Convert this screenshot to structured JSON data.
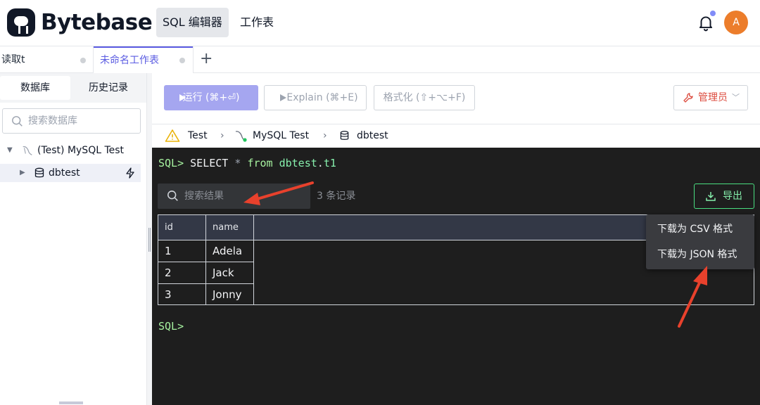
{
  "app": {
    "brand": "Bytebase",
    "accent": "#5b5ce2"
  },
  "header": {
    "nav": [
      {
        "label": "SQL 编辑器",
        "active": true
      },
      {
        "label": "工作表",
        "active": false
      }
    ],
    "avatar_initial": "A"
  },
  "tabs": [
    {
      "label": "读取t",
      "active": false
    },
    {
      "label": "未命名工作表",
      "active": true
    }
  ],
  "sidebar": {
    "tabs": [
      {
        "label": "数据库",
        "active": true
      },
      {
        "label": "历史记录",
        "active": false
      }
    ],
    "search_placeholder": "搜索数据库",
    "tree": [
      {
        "label": "(Test) MySQL Test",
        "expanded": true
      },
      {
        "label": "dbtest",
        "selected": true
      }
    ]
  },
  "toolbar": {
    "run_label": "运行 (⌘+⏎)",
    "explain_label": "Explain (⌘+E)",
    "format_label": "格式化 (⇧+⌥+F)",
    "admin_label": "管理员"
  },
  "breadcrumb": {
    "env": "Test",
    "instance": "MySQL Test",
    "database": "dbtest"
  },
  "editor": {
    "prompt": "SQL>",
    "select": "SELECT",
    "star": "*",
    "from": "from",
    "table_db": "dbtest",
    "table_name": "t1",
    "prompt2": "SQL>"
  },
  "result": {
    "search_placeholder": "搜索结果",
    "count_label": "3 条记录",
    "export_label": "导出",
    "columns": [
      "id",
      "name"
    ],
    "rows": [
      [
        "1",
        "Adela"
      ],
      [
        "2",
        "Jack"
      ],
      [
        "3",
        "Jonny"
      ]
    ]
  },
  "export_menu": {
    "csv": "下载为 CSV 格式",
    "json": "下载为 JSON 格式"
  }
}
